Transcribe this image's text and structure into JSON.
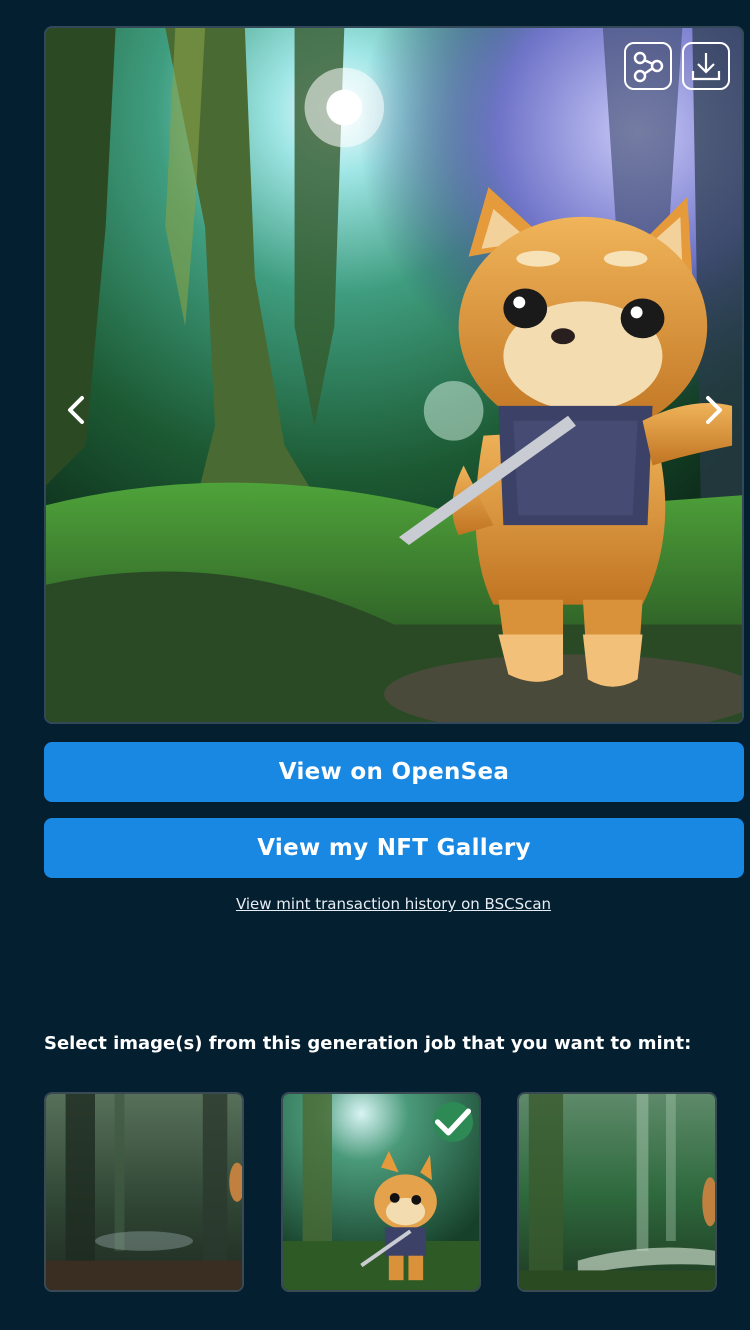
{
  "viewer": {
    "image_alt": "Shiba Inu character holding a sword in a sunlit forest",
    "share_icon": "share-icon",
    "download_icon": "download-icon",
    "prev_icon": "chevron-left-icon",
    "next_icon": "chevron-right-icon"
  },
  "actions": {
    "opensea_label": "View on OpenSea",
    "gallery_label": "View my NFT Gallery",
    "bscscan_link": "View mint transaction history on BSCScan"
  },
  "selection": {
    "heading": "Select image(s) from this generation job that you want to mint:",
    "thumbnails": [
      {
        "selected": false
      },
      {
        "selected": true
      },
      {
        "selected": false
      }
    ]
  },
  "colors": {
    "background": "#041f2f",
    "primary_button": "#1888e3",
    "selected_badge": "#2e8a55"
  }
}
